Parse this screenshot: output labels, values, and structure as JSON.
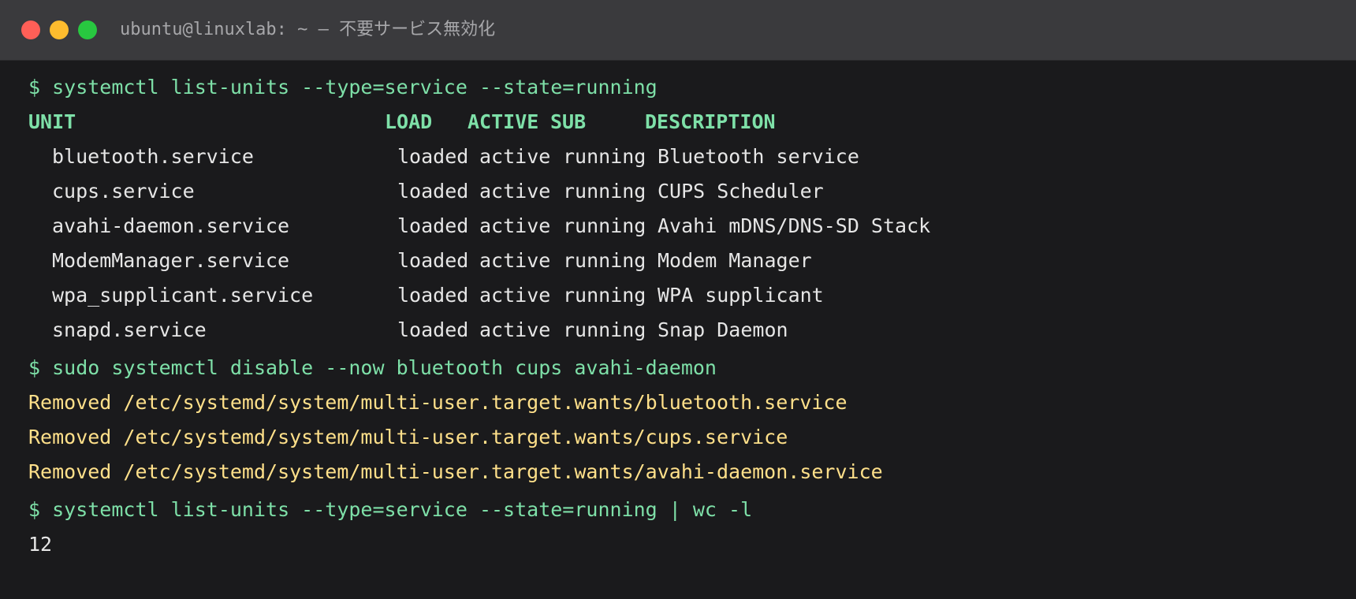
{
  "window": {
    "title": "ubuntu@linuxlab: ~ — 不要サービス無効化"
  },
  "terminal": {
    "cmd1": "$ systemctl list-units --type=service --state=running",
    "header": {
      "unit": "UNIT",
      "load": "LOAD",
      "active": "ACTIVE",
      "sub": "SUB",
      "description": "DESCRIPTION"
    },
    "rows": [
      {
        "unit": "bluetooth.service",
        "load": "loaded",
        "active": "active",
        "sub": "running",
        "description": "Bluetooth service"
      },
      {
        "unit": "cups.service",
        "load": "loaded",
        "active": "active",
        "sub": "running",
        "description": "CUPS Scheduler"
      },
      {
        "unit": "avahi-daemon.service",
        "load": "loaded",
        "active": "active",
        "sub": "running",
        "description": "Avahi mDNS/DNS-SD Stack"
      },
      {
        "unit": "ModemManager.service",
        "load": "loaded",
        "active": "active",
        "sub": "running",
        "description": "Modem Manager"
      },
      {
        "unit": "wpa_supplicant.service",
        "load": "loaded",
        "active": "active",
        "sub": "running",
        "description": "WPA supplicant"
      },
      {
        "unit": "snapd.service",
        "load": "loaded",
        "active": "active",
        "sub": "running",
        "description": "Snap Daemon"
      }
    ],
    "cmd2": "$ sudo systemctl disable --now bluetooth cups avahi-daemon",
    "removed": [
      "Removed /etc/systemd/system/multi-user.target.wants/bluetooth.service",
      "Removed /etc/systemd/system/multi-user.target.wants/cups.service",
      "Removed /etc/systemd/system/multi-user.target.wants/avahi-daemon.service"
    ],
    "cmd3": "$ systemctl list-units --type=service --state=running | wc -l",
    "count": "12"
  }
}
